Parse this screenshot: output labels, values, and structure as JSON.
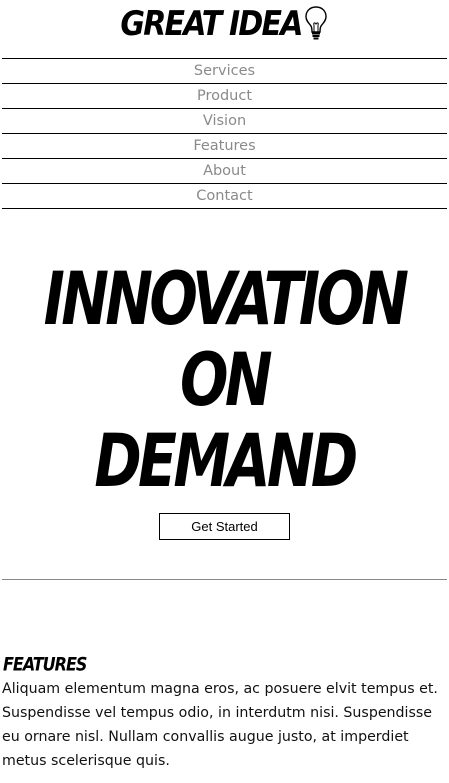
{
  "header": {
    "logo_text": "GREAT IDEA",
    "logo_icon": "lightbulb-icon"
  },
  "nav": {
    "items": [
      {
        "label": "Services"
      },
      {
        "label": "Product"
      },
      {
        "label": "Vision"
      },
      {
        "label": "Features"
      },
      {
        "label": "About"
      },
      {
        "label": "Contact"
      }
    ]
  },
  "hero": {
    "headline_lines": [
      "INNOVATION",
      "ON",
      "DEMAND"
    ],
    "cta_label": "Get Started"
  },
  "features": {
    "heading": "FEATURES",
    "body": "Aliquam elementum magna eros, ac posuere elvit tempus et. Suspendisse vel tempus odio, in interdutm nisi. Suspendisse eu ornare nisl. Nullam convallis augue justo, at imperdiet metus scelerisque quis."
  },
  "colors": {
    "text": "#000000",
    "nav_text": "#8a8a8a",
    "background": "#ffffff"
  }
}
